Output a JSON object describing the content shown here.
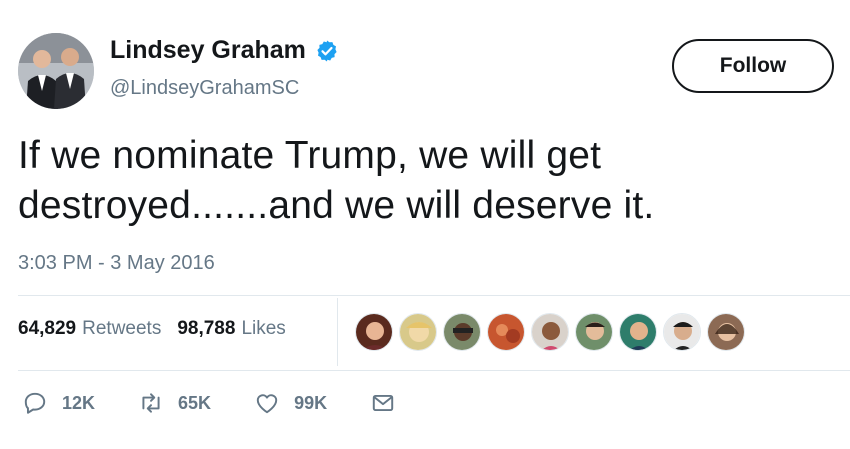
{
  "author": {
    "name": "Lindsey Graham",
    "handle": "@LindseyGrahamSC",
    "verified": true
  },
  "follow_label": "Follow",
  "tweet": {
    "text_line1": "If we nominate Trump, we will get",
    "text_line2": "destroyed.......and we will deserve it.",
    "timestamp": "3:03 PM - 3 May 2016"
  },
  "stats": {
    "retweets_count": "64,829",
    "retweets_label": "Retweets",
    "likes_count": "98,788",
    "likes_label": "Likes"
  },
  "likers": [
    {
      "icon": "liker-avatar-1"
    },
    {
      "icon": "liker-avatar-2"
    },
    {
      "icon": "liker-avatar-3"
    },
    {
      "icon": "liker-avatar-4"
    },
    {
      "icon": "liker-avatar-5"
    },
    {
      "icon": "liker-avatar-6"
    },
    {
      "icon": "liker-avatar-7"
    },
    {
      "icon": "liker-avatar-8"
    },
    {
      "icon": "liker-avatar-9"
    }
  ],
  "actions": {
    "reply": {
      "icon": "reply-icon",
      "count": "12K"
    },
    "retweet": {
      "icon": "retweet-icon",
      "count": "65K"
    },
    "like": {
      "icon": "heart-icon",
      "count": "99K"
    },
    "message": {
      "icon": "mail-icon"
    }
  },
  "colors": {
    "text": "#14171a",
    "secondary": "#657786",
    "verified_blue": "#1da1f2",
    "divider": "#e1e8ed"
  }
}
